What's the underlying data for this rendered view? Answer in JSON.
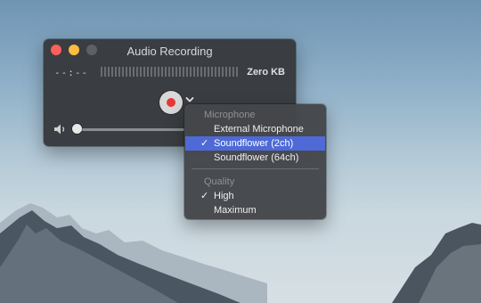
{
  "window": {
    "title": "Audio Recording",
    "elapsed_time": "--:--",
    "file_size": "Zero KB",
    "volume_level": 0
  },
  "menu": {
    "sections": [
      {
        "header": "Microphone",
        "items": [
          {
            "label": "External Microphone",
            "checked": false,
            "highlighted": false
          },
          {
            "label": "Soundflower (2ch)",
            "checked": true,
            "highlighted": true
          },
          {
            "label": "Soundflower (64ch)",
            "checked": false,
            "highlighted": false
          }
        ]
      },
      {
        "header": "Quality",
        "items": [
          {
            "label": "High",
            "checked": true,
            "highlighted": false
          },
          {
            "label": "Maximum",
            "checked": false,
            "highlighted": false
          }
        ]
      }
    ],
    "checkmark": "✓"
  },
  "colors": {
    "accent_highlight": "#4f6ad6",
    "record_red": "#e53935",
    "close_red": "#fc605c",
    "minimize_yellow": "#fdbc40"
  },
  "icons": [
    "close-icon",
    "minimize-icon",
    "zoom-icon",
    "record-icon",
    "chevron-down-icon",
    "speaker-icon"
  ]
}
